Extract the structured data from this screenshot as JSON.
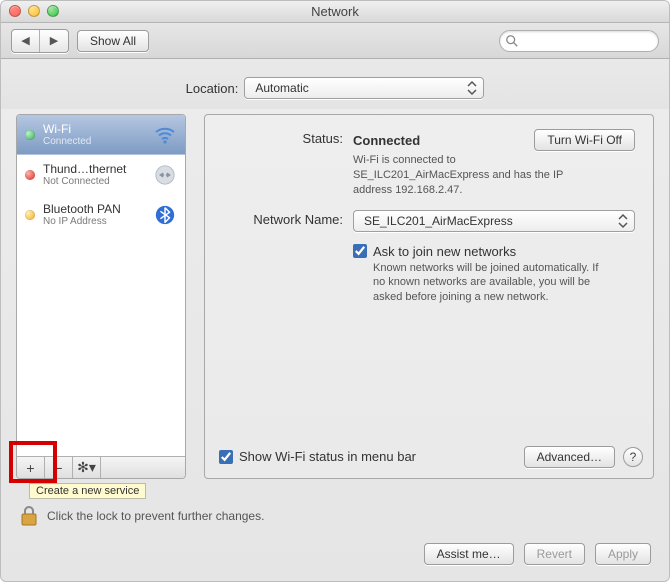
{
  "window_title": "Network",
  "toolbar": {
    "show_all": "Show All"
  },
  "location": {
    "label": "Location:",
    "value": "Automatic"
  },
  "sidebar": {
    "services": [
      {
        "name": "Wi-Fi",
        "status": "Connected",
        "dot": "green",
        "icon": "wifi",
        "selected": true
      },
      {
        "name": "Thund…thernet",
        "status": "Not Connected",
        "dot": "red",
        "icon": "ethernet",
        "selected": false
      },
      {
        "name": "Bluetooth PAN",
        "status": "No IP Address",
        "dot": "amber",
        "icon": "bluetooth",
        "selected": false
      }
    ],
    "tooltip_add": "Create a new service"
  },
  "detail": {
    "status_label": "Status:",
    "status_value": "Connected",
    "turn_off_label": "Turn Wi-Fi Off",
    "status_desc": "Wi-Fi is connected to SE_ILC201_AirMacExpress and has the IP address 192.168.2.47.",
    "netname_label": "Network Name:",
    "netname_value": "SE_ILC201_AirMacExpress",
    "ask_join_label": "Ask to join new networks",
    "ask_join_desc": "Known networks will be joined automatically. If no known networks are available, you will be asked before joining a new network.",
    "show_menu_bar_label": "Show Wi-Fi status in menu bar",
    "advanced_label": "Advanced…"
  },
  "footer": {
    "lock_text": "Click the lock to prevent further changes.",
    "assist": "Assist me…",
    "revert": "Revert",
    "apply": "Apply"
  }
}
